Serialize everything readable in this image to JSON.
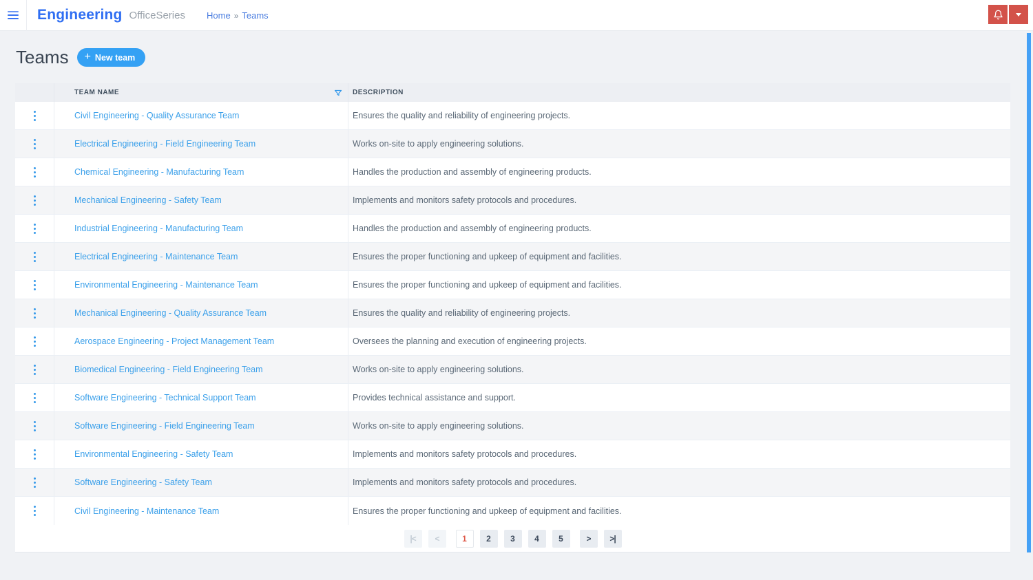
{
  "header": {
    "app_title": "Engineering",
    "app_subtitle": "OfficeSeries",
    "breadcrumb": {
      "home": "Home",
      "separator": "»",
      "current": "Teams"
    }
  },
  "page": {
    "title": "Teams",
    "new_team_label": "New team",
    "plus_glyph": "+"
  },
  "table": {
    "columns": {
      "team_name": "TEAM NAME",
      "description": "DESCRIPTION"
    },
    "rows": [
      {
        "team_name": "Civil Engineering - Quality Assurance Team",
        "description": "Ensures the quality and reliability of engineering projects."
      },
      {
        "team_name": "Electrical Engineering - Field Engineering Team",
        "description": "Works on-site to apply engineering solutions."
      },
      {
        "team_name": "Chemical Engineering - Manufacturing Team",
        "description": "Handles the production and assembly of engineering products."
      },
      {
        "team_name": "Mechanical Engineering - Safety Team",
        "description": "Implements and monitors safety protocols and procedures."
      },
      {
        "team_name": "Industrial Engineering - Manufacturing Team",
        "description": "Handles the production and assembly of engineering products."
      },
      {
        "team_name": "Electrical Engineering - Maintenance Team",
        "description": "Ensures the proper functioning and upkeep of equipment and facilities."
      },
      {
        "team_name": "Environmental Engineering - Maintenance Team",
        "description": "Ensures the proper functioning and upkeep of equipment and facilities."
      },
      {
        "team_name": "Mechanical Engineering - Quality Assurance Team",
        "description": "Ensures the quality and reliability of engineering projects."
      },
      {
        "team_name": "Aerospace Engineering - Project Management Team",
        "description": "Oversees the planning and execution of engineering projects."
      },
      {
        "team_name": "Biomedical Engineering - Field Engineering Team",
        "description": "Works on-site to apply engineering solutions."
      },
      {
        "team_name": "Software Engineering - Technical Support Team",
        "description": "Provides technical assistance and support."
      },
      {
        "team_name": "Software Engineering - Field Engineering Team",
        "description": "Works on-site to apply engineering solutions."
      },
      {
        "team_name": "Environmental Engineering - Safety Team",
        "description": "Implements and monitors safety protocols and procedures."
      },
      {
        "team_name": "Software Engineering - Safety Team",
        "description": "Implements and monitors safety protocols and procedures."
      },
      {
        "team_name": "Civil Engineering - Maintenance Team",
        "description": "Ensures the proper functioning and upkeep of equipment and facilities."
      }
    ]
  },
  "pagination": {
    "first_label": "|<",
    "prev_label": "<",
    "pages": [
      "1",
      "2",
      "3",
      "4",
      "5"
    ],
    "active_page": "1",
    "next_label": ">",
    "last_label": ">|"
  },
  "icons": {
    "hamburger": "menu-icon",
    "bell": "notifications-icon",
    "caret": "dropdown-caret-icon",
    "funnel": "filter-icon",
    "kebab": "row-menu-icon"
  },
  "colors": {
    "brand_blue": "#2f6ef2",
    "accent_blue": "#34a1f4",
    "link_blue": "#3ba0ea",
    "alert_red": "#d3524a",
    "active_page_red": "#df5a4a",
    "scrollbar_blue": "#45a1f6",
    "page_background": "#f0f2f5",
    "table_header_bg": "#edeff3",
    "row_alt_bg": "#f4f5f7"
  }
}
